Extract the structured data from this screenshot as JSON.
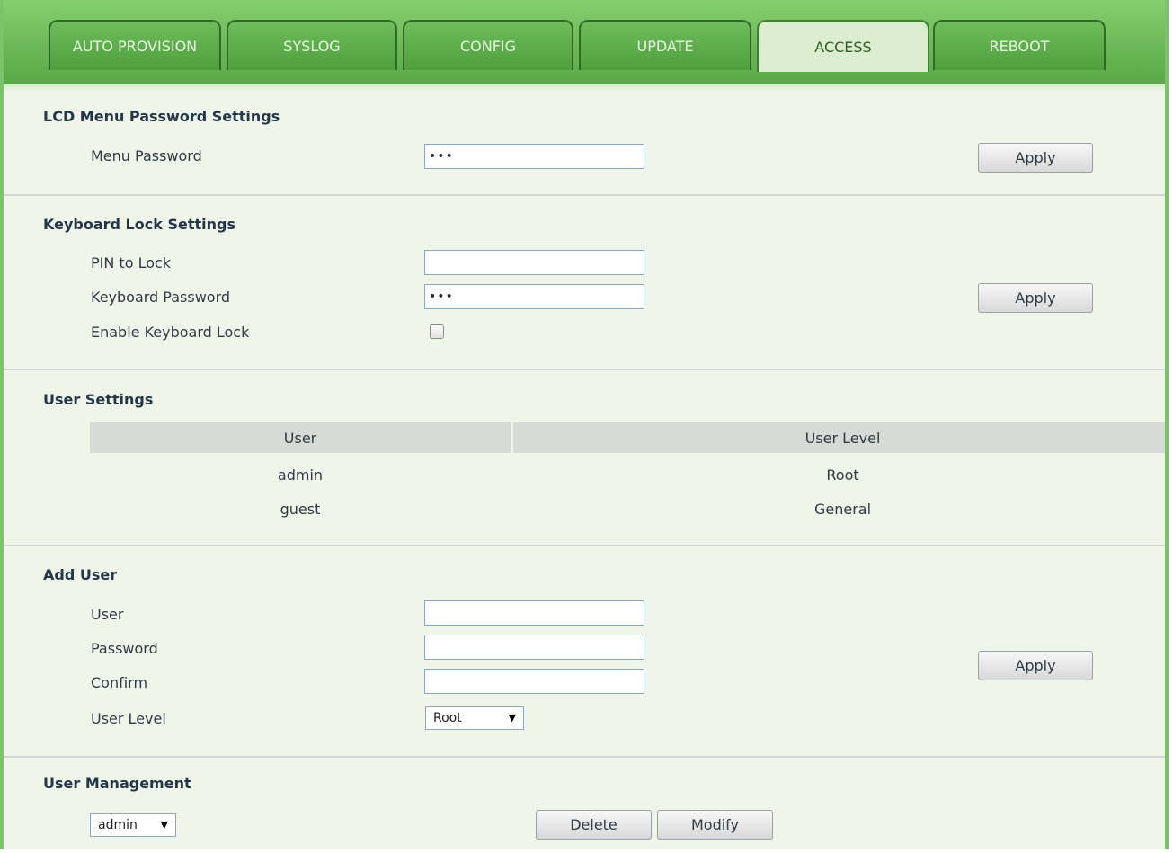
{
  "tabs": [
    {
      "label": "AUTO PROVISION",
      "active": false
    },
    {
      "label": "SYSLOG",
      "active": false
    },
    {
      "label": "CONFIG",
      "active": false
    },
    {
      "label": "UPDATE",
      "active": false
    },
    {
      "label": "ACCESS",
      "active": true
    },
    {
      "label": "REBOOT",
      "active": false
    }
  ],
  "lcd": {
    "title": "LCD Menu Password Settings",
    "menu_password_label": "Menu Password",
    "menu_password_value": "•••",
    "apply_label": "Apply"
  },
  "keyboard": {
    "title": "Keyboard Lock Settings",
    "pin_label": "PIN to Lock",
    "pin_value": "",
    "password_label": "Keyboard Password",
    "password_value": "•••",
    "enable_label": "Enable Keyboard Lock",
    "enable_checked": false,
    "apply_label": "Apply"
  },
  "user_settings": {
    "title": "User Settings",
    "columns": [
      "User",
      "User Level"
    ],
    "rows": [
      [
        "admin",
        "Root"
      ],
      [
        "guest",
        "General"
      ]
    ]
  },
  "add_user": {
    "title": "Add User",
    "user_label": "User",
    "password_label": "Password",
    "confirm_label": "Confirm",
    "level_label": "User Level",
    "level_selected": "Root",
    "apply_label": "Apply"
  },
  "user_management": {
    "title": "User Management",
    "selected_user": "admin",
    "delete_label": "Delete",
    "modify_label": "Modify"
  },
  "colors": {
    "tabbar": "#6cb859",
    "active_tab": "#dcedd0",
    "page_bg": "#f0f5ea",
    "title_text": "#23364a"
  },
  "icons": {
    "dropdown_arrow": "▼"
  }
}
